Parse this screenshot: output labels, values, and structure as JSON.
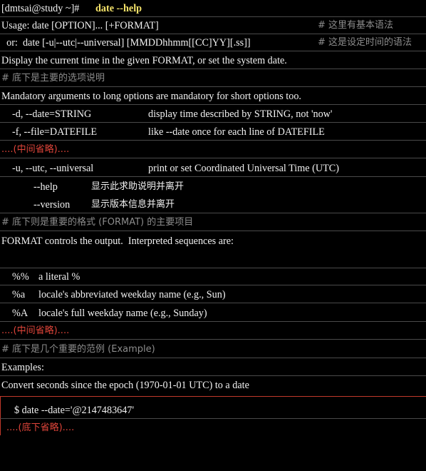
{
  "terminal": {
    "prompt": "[dmtsai@study ~]# ",
    "command": "date --help",
    "usage1": "Usage: date [OPTION]... [+FORMAT]",
    "usage1_comment": "# 这里有基本语法",
    "usage2": "  or:  date [-u|--utc|--universal] [MMDDhhmm[[CC]YY][.ss]]",
    "usage2_comment": "# 这是设定时间的语法",
    "description": "Display the current time in the given FORMAT, or set the system date.",
    "comment_options": "# 底下是主要的选项说明",
    "mandatory": "Mandatory arguments to long options are mandatory for short options too.",
    "opt_date_flag": "-d, --date=STRING",
    "opt_date_desc": "display time described by STRING, not 'now'",
    "opt_file_flag": "-f, --file=DATEFILE",
    "opt_file_desc": "like --date once for each line of DATEFILE",
    "omitted_middle_1": "....(中间省略)....",
    "opt_utc_flag": "-u, --utc, --universal",
    "opt_utc_desc": "print or set Coordinated Universal Time (UTC)",
    "opt_help_flag": "--help",
    "opt_help_desc": "显示此求助说明并离开",
    "opt_version_flag": "--version",
    "opt_version_desc": "显示版本信息并离开",
    "comment_format": "# 底下则是重要的格式 (FORMAT) 的主要项目",
    "format_controls": "FORMAT controls the output.  Interpreted sequences are:",
    "fmt_pct_flag": "%%",
    "fmt_pct_desc": "a literal %",
    "fmt_a_flag": "%a",
    "fmt_a_desc": "locale's abbreviated weekday name (e.g., Sun)",
    "fmt_A_flag": "%A",
    "fmt_A_desc": "locale's full weekday name (e.g., Sunday)",
    "omitted_middle_2": "....(中间省略)....",
    "comment_examples": "# 底下是几个重要的范例 (Example)",
    "examples_label": "Examples:",
    "convert_seconds": "Convert seconds since the epoch (1970-01-01 UTC) to a date",
    "example_command": "$ date --date='@2147483647'",
    "omitted_below": "....(底下省略)...."
  }
}
